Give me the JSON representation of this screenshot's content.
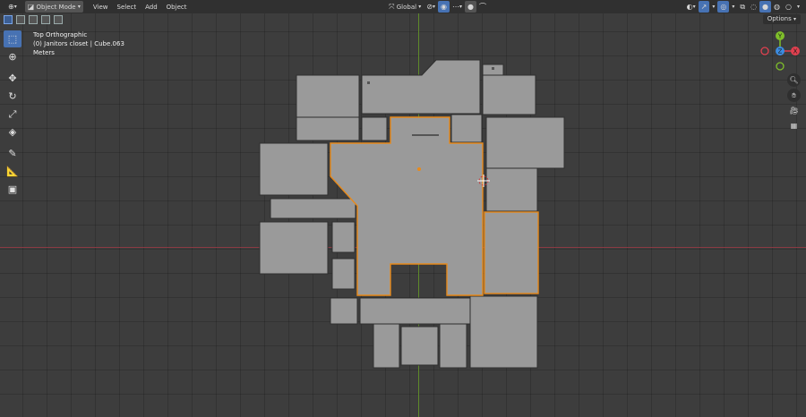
{
  "header": {
    "editor_icon": "view3d-icon",
    "mode_label": "Object Mode",
    "menu": [
      "View",
      "Select",
      "Add",
      "Object"
    ],
    "orientation_label": "Global",
    "colors": {
      "header_bg": "#303030",
      "accent": "#4772b3",
      "viewport_bg": "#3d3d3d"
    }
  },
  "overlay_info": {
    "view_name": "Top Orthographic",
    "object_info": "(0) Janitors closet | Cube.063",
    "units": "Meters"
  },
  "options_label": "Options",
  "toolbar": [
    "select-box-icon",
    "cursor-icon",
    "move-icon",
    "rotate-icon",
    "scale-icon",
    "transform-icon",
    "annotate-icon",
    "measure-icon",
    "add-cube-icon"
  ],
  "gizmo": {
    "x_label": "X",
    "y_label": "Y",
    "z_label": "Z"
  },
  "nav_buttons": [
    "zoom-icon",
    "hand-pan-icon",
    "camera-icon",
    "grid-icon"
  ]
}
